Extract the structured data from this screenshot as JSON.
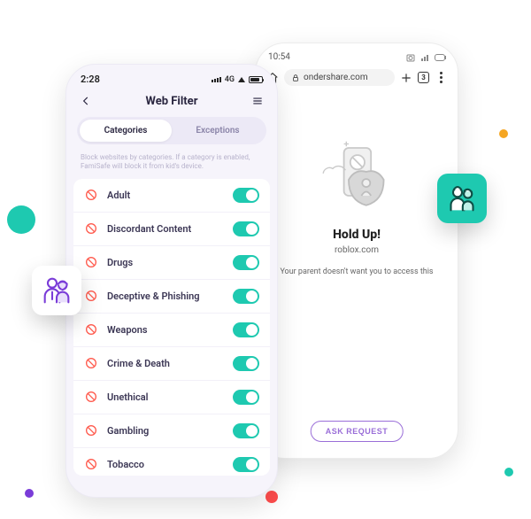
{
  "phone_left": {
    "time": "2:28",
    "signal_label": "4G",
    "header_title": "Web Filter",
    "tabs": {
      "categories": "Categories",
      "exceptions": "Exceptions"
    },
    "helper_text": "Block websites by categories. If a category is enabled, FamiSafe will block it from kid's device.",
    "categories": [
      {
        "label": "Adult"
      },
      {
        "label": "Discordant Content"
      },
      {
        "label": "Drugs"
      },
      {
        "label": "Deceptive & Phishing"
      },
      {
        "label": "Weapons"
      },
      {
        "label": "Crime & Death"
      },
      {
        "label": "Unethical"
      },
      {
        "label": "Gambling"
      },
      {
        "label": "Tobacco"
      }
    ]
  },
  "phone_right": {
    "time": "10:54",
    "address_text": "ondershare.com",
    "tab_count": "3",
    "block_title": "Hold Up!",
    "block_site": "roblox.com",
    "block_message": "Your parent doesn't want you to access this",
    "ask_button": "ASK REQUEST"
  }
}
